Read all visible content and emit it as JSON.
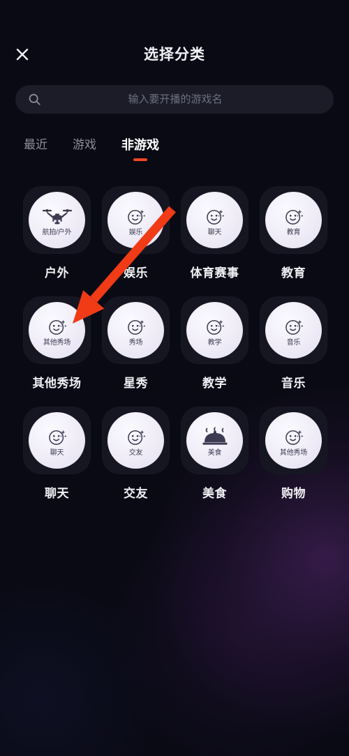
{
  "header": {
    "title": "选择分类",
    "close_icon": "close-icon"
  },
  "search": {
    "placeholder": "输入要开播的游戏名",
    "value": "",
    "icon": "search-icon"
  },
  "tabs": [
    {
      "label": "最近",
      "active": false
    },
    {
      "label": "游戏",
      "active": false
    },
    {
      "label": "非游戏",
      "active": true
    }
  ],
  "colors": {
    "accent": "#f04522",
    "annotation_arrow": "#f03b16",
    "background": "#080a14",
    "tile": "#161622",
    "disc": "#efecf7",
    "text_primary": "#f0f0f4",
    "text_muted": "#8d8f9c",
    "search_bg": "#1b1c27"
  },
  "categories": [
    {
      "label": "户外",
      "disc_text": "航拍/户外",
      "icon": "drone-icon"
    },
    {
      "label": "娱乐",
      "disc_text": "娱乐",
      "icon": "smiley-sparkle-icon"
    },
    {
      "label": "体育赛事",
      "disc_text": "聊天",
      "icon": "smiley-sparkle-icon"
    },
    {
      "label": "教育",
      "disc_text": "教育",
      "icon": "smiley-sparkle-icon"
    },
    {
      "label": "其他秀场",
      "disc_text": "其他秀场",
      "icon": "smiley-sparkle-icon"
    },
    {
      "label": "星秀",
      "disc_text": "秀场",
      "icon": "smiley-sparkle-icon"
    },
    {
      "label": "教学",
      "disc_text": "教学",
      "icon": "smiley-sparkle-icon"
    },
    {
      "label": "音乐",
      "disc_text": "音乐",
      "icon": "smiley-sparkle-icon"
    },
    {
      "label": "聊天",
      "disc_text": "聊天",
      "icon": "smiley-sparkle-icon"
    },
    {
      "label": "交友",
      "disc_text": "交友",
      "icon": "smiley-sparkle-icon"
    },
    {
      "label": "美食",
      "disc_text": "美食",
      "icon": "food-dome-icon"
    },
    {
      "label": "购物",
      "disc_text": "其他秀场",
      "icon": "smiley-sparkle-icon"
    }
  ],
  "annotation": {
    "type": "arrow",
    "points_to": "其他秀场",
    "from": [
      247,
      300
    ],
    "to": [
      104,
      464
    ]
  }
}
